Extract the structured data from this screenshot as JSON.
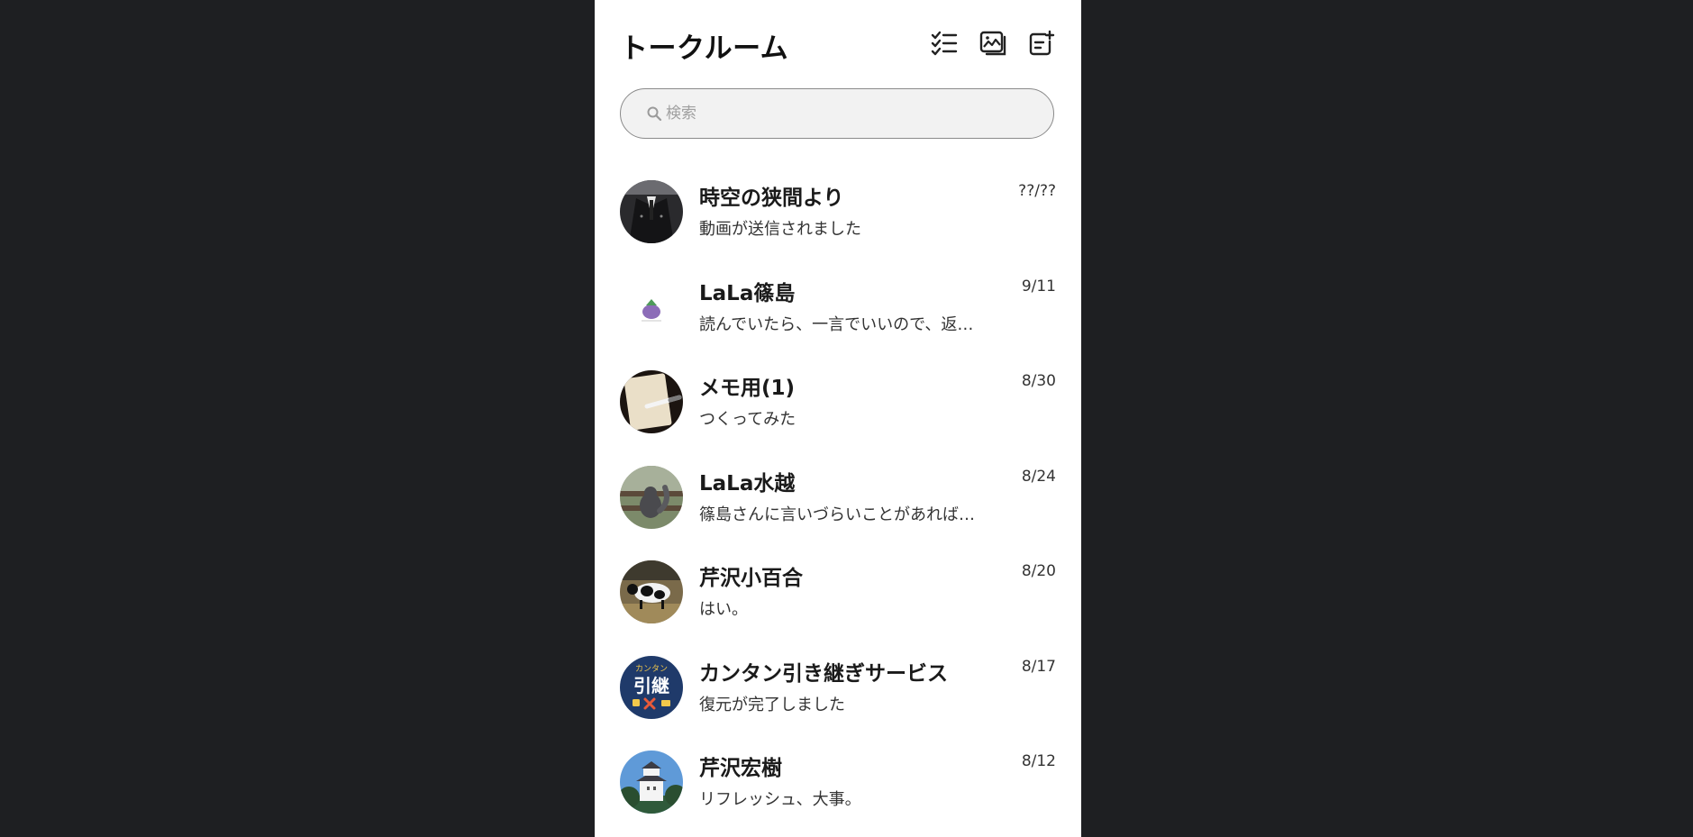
{
  "header": {
    "title": "トークルーム",
    "icons": [
      "checklist-icon",
      "image-gallery-icon",
      "new-chat-icon"
    ]
  },
  "search": {
    "placeholder": "検索",
    "value": ""
  },
  "chats": [
    {
      "name": "時空の狭間より",
      "preview": "動画が送信されました",
      "date": "??/??",
      "avatar": "dark-jacket-photo"
    },
    {
      "name": "LaLa篠島",
      "preview": "読んでいたら、一言でいいので、返信ください",
      "date": "9/11",
      "avatar": "eggplant-illustration"
    },
    {
      "name": "メモ用(1)",
      "preview": "つくってみた",
      "date": "8/30",
      "avatar": "notepad-pen-photo"
    },
    {
      "name": "LaLa水越",
      "preview": "篠島さんに言いづらいことがあれば教えてください",
      "date": "8/24",
      "avatar": "squirrel-photo"
    },
    {
      "name": "芹沢小百合",
      "preview": "はい。",
      "date": "8/20",
      "avatar": "cow-photo"
    },
    {
      "name": "カンタン引き継ぎサービス",
      "preview": "復元が完了しました",
      "date": "8/17",
      "avatar": "transfer-service-logo",
      "avatar_text_top": "カンタン",
      "avatar_text_main": "引継"
    },
    {
      "name": "芹沢宏樹",
      "preview": "リフレッシュ、大事。",
      "date": "8/12",
      "avatar": "castle-photo"
    }
  ]
}
